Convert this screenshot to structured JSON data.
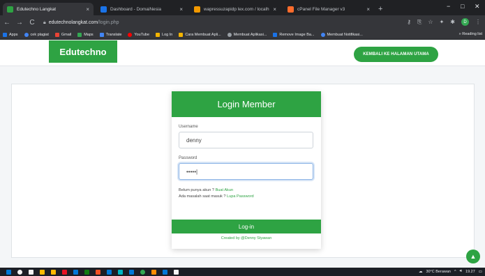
{
  "browser": {
    "tabs": [
      {
        "title": "Edutechno Langkat",
        "active": true,
        "favicon_color": "#2ea343"
      },
      {
        "title": "Dashboard - DomaiNesia",
        "active": false,
        "favicon_color": "#1a73e8"
      },
      {
        "title": "wapressuzapidp lex.com / localh...",
        "active": false,
        "favicon_color": "#f29900"
      },
      {
        "title": "cPanel File Manager v3",
        "active": false,
        "favicon_color": "#ff6c2c"
      }
    ],
    "tab_close": "×",
    "new_tab": "+",
    "window_controls": {
      "minimize": "−",
      "maximize": "□",
      "close": "✕"
    },
    "nav": {
      "back": "←",
      "forward": "→",
      "reload": "C"
    },
    "address": {
      "domain": "edutechnolangkat.com",
      "path": "/login.php"
    },
    "profile_initial": "D",
    "bookmarks": [
      {
        "label": "Apps",
        "color": "#1a73e8"
      },
      {
        "label": "cek plagiat",
        "color": "#4285f4"
      },
      {
        "label": "Gmail",
        "color": "#ea4335"
      },
      {
        "label": "Maps",
        "color": "#34a853"
      },
      {
        "label": "Translate",
        "color": "#4285f4"
      },
      {
        "label": "YouTube",
        "color": "#ff0000"
      },
      {
        "label": "Log In",
        "color": "#f4b400"
      },
      {
        "label": "Cara Membuat Apli...",
        "color": "#f4b400"
      },
      {
        "label": "Membuat Aplikasi...",
        "color": "#9aa0a6"
      },
      {
        "label": "Remove Image Ba...",
        "color": "#1a73e8"
      },
      {
        "label": "Membuat Notifikasi...",
        "color": "#4285f4"
      }
    ],
    "bookmarks_more": "»  Reading list"
  },
  "site": {
    "brand": "Edutechno",
    "home_button": "KEMBALI KE HALAMAN UTAMA"
  },
  "login": {
    "title": "Login Member",
    "username_label": "Username",
    "username_value": "denny",
    "password_label": "Password",
    "password_value": "•••••|",
    "register_text": "Belum punya akun ?",
    "register_link": "Buat Akun",
    "forgot_text": "Ada masalah saat masuk ?",
    "forgot_link": "Lupa Password",
    "submit": "Log-in",
    "credit": "Created by @Denny Styawan"
  },
  "scroll_top": "▲",
  "taskbar": {
    "icons": [
      "#0078d7",
      "#f3f3f3",
      "#f3f3f3",
      "#ffb900",
      "#ffb900",
      "#e81123",
      "#0078d7",
      "#107c10",
      "#f25022",
      "#0078d7",
      "#00b7c3",
      "#0078d7",
      "#0078d7",
      "#ff8c00",
      "#0078d7",
      "#f3f3f3"
    ],
    "weather": "30°C Berawan",
    "time": "19.27"
  },
  "accent_color": "#2ea343"
}
